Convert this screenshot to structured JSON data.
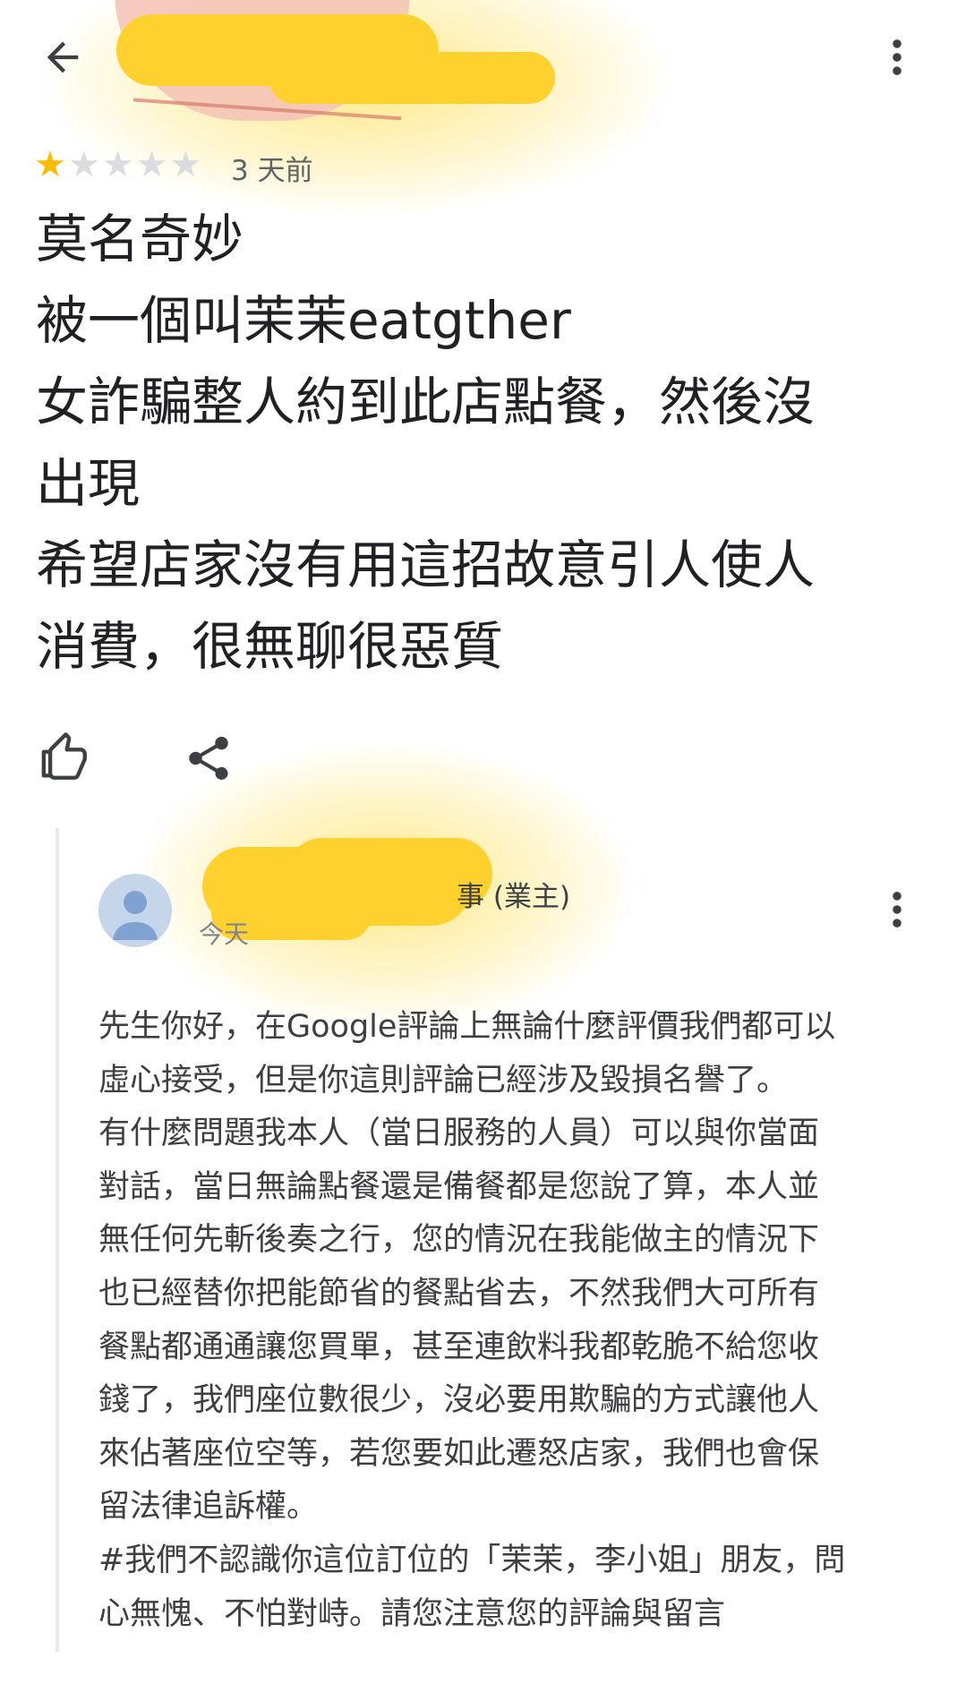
{
  "header": {
    "back_icon": "arrow-left-icon",
    "more_icon": "more-vert-icon"
  },
  "rating": {
    "stars": 1,
    "max_stars": 5,
    "time": "3 天前",
    "filled_color": "#fbbc04",
    "empty_color": "#dadce0"
  },
  "review": {
    "lines": [
      "莫名奇妙",
      "被一個叫茉茉eatgther",
      "女詐騙整人約到此店點餐，然後沒",
      "出現",
      "希望店家沒有用這招故意引人使人",
      "消費，很無聊很惡質"
    ]
  },
  "actions": {
    "like_icon": "thumb-up-icon",
    "share_icon": "share-icon"
  },
  "owner_reply": {
    "name_visible": "事 (業主)",
    "time": "今天",
    "avatar_icon": "person-avatar-icon",
    "lines": [
      "先生你好，在Google評論上無論什麼評價我們都可以",
      "虛心接受，但是你這則評論已經涉及毀損名譽了。",
      "有什麼問題我本人（當日服務的人員）可以與你當面",
      "對話，當日無論點餐還是備餐都是您說了算，本人並",
      "無任何先斬後奏之行，您的情況在我能做主的情況下",
      "也已經替你把能節省的餐點省去，不然我們大可所有",
      "餐點都通通讓您買單，甚至連飲料我都乾脆不給您收",
      "錢了，我們座位數很少，沒必要用欺騙的方式讓他人",
      "來佔著座位空等，若您要如此遷怒店家，我們也會保",
      "留法律追訴權。",
      "#我們不認識你這位訂位的「茉茉，李小姐」朋友，問",
      "心無愧、不怕對峙。請您注意您的評論與留言"
    ]
  }
}
